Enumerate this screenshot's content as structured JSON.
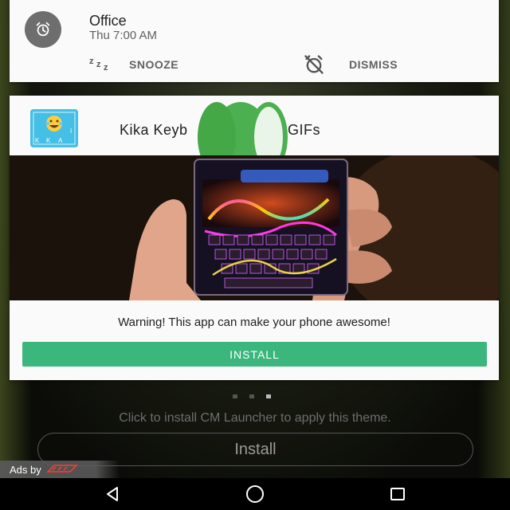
{
  "alarm": {
    "title": "Office",
    "time": "Thu 7:00 AM",
    "snooze_label": "SNOOZE",
    "snooze_glyph": "z z z",
    "dismiss_label": "DISMISS",
    "icon": "alarm-clock-icon"
  },
  "ad": {
    "app_title": "Kika Keyb",
    "app_title_suffix": "jis, GIFs",
    "app_icon": "kika-keyboard-icon",
    "app_icon_emoji": "😂",
    "app_icon_keys": [
      "K",
      "I",
      "K",
      "A"
    ],
    "warning": "Warning!  This app can make your phone awesome!",
    "install_label": "INSTALL",
    "accent_color": "#3bb77e"
  },
  "pager": {
    "count": 3,
    "active": 2
  },
  "hint": "Click to install CM Launcher to apply this theme.",
  "install_label": "Install",
  "ads_by": "Ads by",
  "ads_brand": "cm",
  "nav": {
    "back_icon": "back-triangle-icon",
    "home_icon": "home-circle-icon",
    "recents_icon": "recents-square-icon"
  }
}
